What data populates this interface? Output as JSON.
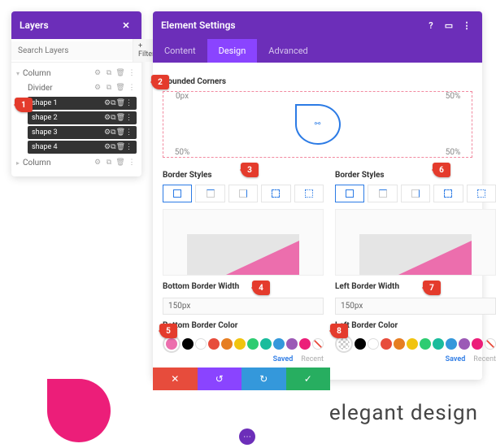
{
  "layers": {
    "title": "Layers",
    "search_placeholder": "Search Layers",
    "filter_label": "+ Filter",
    "column_label_top": "Column",
    "divider_label": "Divider",
    "shapes": [
      "shape 1",
      "shape 2",
      "shape 3",
      "shape 4"
    ],
    "column_label_bottom": "Column"
  },
  "settings": {
    "title": "Element Settings",
    "tabs": {
      "content": "Content",
      "design": "Design",
      "advanced": "Advanced"
    },
    "rounded_corners": {
      "title": "Rounded Corners",
      "tl": "0px",
      "tr": "50%",
      "bl": "50%",
      "br": "50%"
    },
    "border_styles_title": "Border Styles",
    "bottom_width_title": "Bottom Border Width",
    "bottom_width_value": "150px",
    "bottom_color_title": "Bottom Border Color",
    "left_width_title": "Left Border Width",
    "left_width_value": "150px",
    "left_color_title": "Left Border Color",
    "saved": "Saved",
    "recent": "Recent"
  },
  "palette": [
    "#000000",
    "#ffffff",
    "#e74c3c",
    "#e67e22",
    "#f1c40f",
    "#2ecc71",
    "#1abc9c",
    "#3498db",
    "#9b59b6",
    "#ec1e79"
  ],
  "picker_color": "#ec6ead",
  "brand_text": "elegant design",
  "callouts": [
    "1",
    "2",
    "3",
    "4",
    "5",
    "6",
    "7",
    "8"
  ]
}
